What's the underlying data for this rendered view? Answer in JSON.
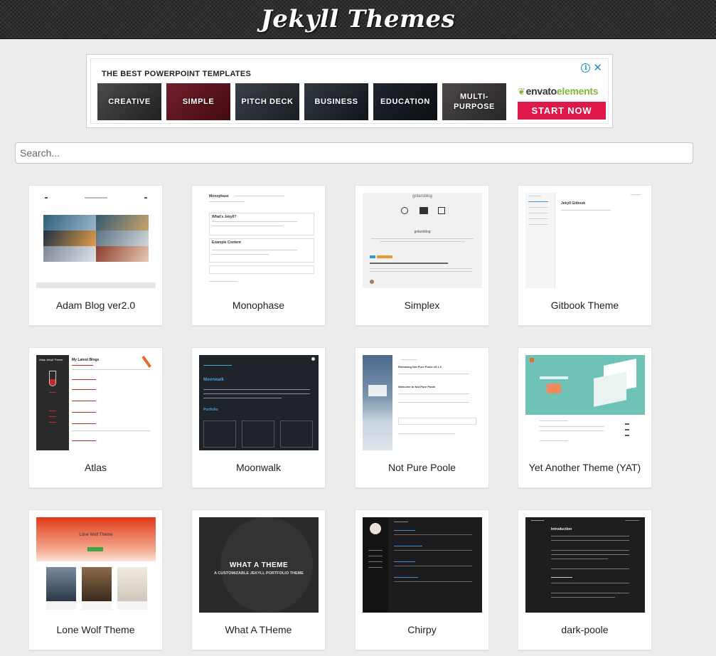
{
  "header": {
    "title": "Jekyll Themes"
  },
  "ad": {
    "title": "THE BEST POWERPOINT TEMPLATES",
    "tiles": [
      {
        "label": "CREATIVE",
        "color": "#6b6b6b"
      },
      {
        "label": "SIMPLE",
        "color": "#b3263a"
      },
      {
        "label": "PITCH DECK",
        "color": "#4b5662"
      },
      {
        "label": "BUSINESS",
        "color": "#3d4a57"
      },
      {
        "label": "EDUCATION",
        "color": "#27323f"
      },
      {
        "label": "MULTI-PURPOSE",
        "color": "#6e6a68"
      }
    ],
    "brand": {
      "part1": "envato",
      "part2": "elements"
    },
    "cta": "START NOW",
    "cta_color": "#e0174b"
  },
  "search": {
    "placeholder": "Search..."
  },
  "themes": [
    {
      "name": "Adam Blog ver2.0"
    },
    {
      "name": "Monophase"
    },
    {
      "name": "Simplex"
    },
    {
      "name": "Gitbook Theme"
    },
    {
      "name": "Atlas"
    },
    {
      "name": "Moonwalk"
    },
    {
      "name": "Not Pure Poole"
    },
    {
      "name": "Yet Another Theme (YAT)"
    },
    {
      "name": "Lone Wolf Theme"
    },
    {
      "name": "What A THeme"
    },
    {
      "name": "Chirpy"
    },
    {
      "name": "dark-poole"
    }
  ],
  "thumbnails": {
    "what_a_theme": {
      "title": "WHAT A THEME",
      "subtitle": "A CUSTOMIZABLE JEKYLL PORTFOLIO THEME"
    },
    "lone_wolf": {
      "title": "Lone Wolf Theme"
    },
    "moonwalk": {
      "title": "Moonwalk",
      "portfolio": "Portfolio"
    },
    "simplex": {
      "brand": "golarsblog"
    },
    "gitbook": {
      "title": "Jekyll Gitbook"
    },
    "atlas": {
      "title": "My Latest Blogs",
      "sidebar": "Atlas Jekyll Theme"
    },
    "monophase": {
      "title": "Monophase",
      "post1": "What's Jekyll?",
      "post2": "Example Content"
    },
    "notpure": {
      "post1": "Releasing Not Pure Poole v0.1.0",
      "post2": "Welcome to Not Pure Poole"
    },
    "darkpoole": {
      "title": "Introduction"
    }
  }
}
